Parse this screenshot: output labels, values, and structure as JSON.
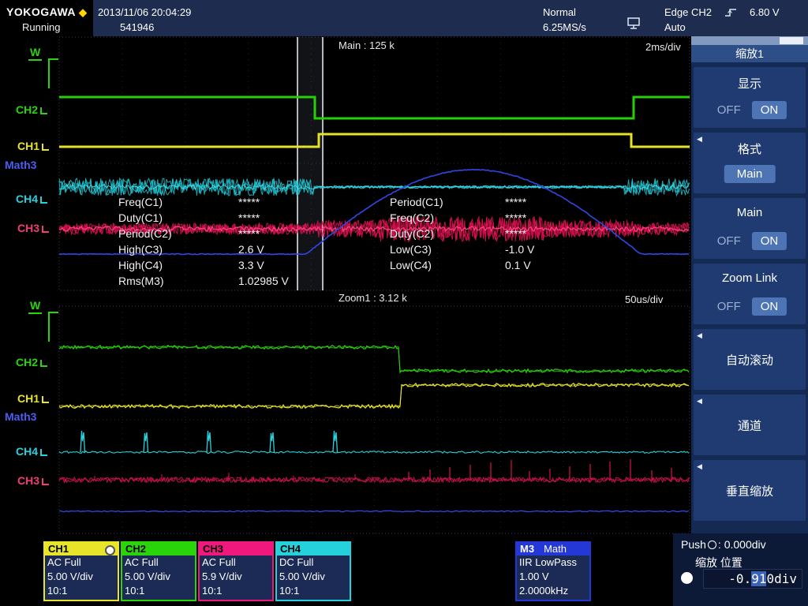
{
  "topbar": {
    "brand": "YOKOGAWA",
    "diamond": "◆",
    "datetime": "2013/11/06 20:04:29",
    "acq_count": "541946",
    "run_state": "Running",
    "trigger_mode": "Normal",
    "sample_rate": "6.25MS/s",
    "trigger_source": "Edge CH2",
    "trigger_level": "6.80 V",
    "trigger_sweep": "Auto"
  },
  "main_window": {
    "record_label": "Main : 125 k",
    "timebase": "2ms/div"
  },
  "zoom_window": {
    "record_label": "Zoom1 : 3.12 k",
    "timebase": "50us/div",
    "marker": "W"
  },
  "trace_labels": {
    "ch1": "CH1",
    "ch2": "CH2",
    "ch3": "CH3",
    "ch4": "CH4",
    "math3": "Math3"
  },
  "measurements": {
    "col1": [
      {
        "label": "Freq(C1)",
        "value": "*****"
      },
      {
        "label": "Duty(C1)",
        "value": "*****"
      },
      {
        "label": "Period(C2)",
        "value": "*****"
      },
      {
        "label": "High(C3)",
        "value": "2.6 V"
      },
      {
        "label": "High(C4)",
        "value": "3.3 V"
      },
      {
        "label": "Rms(M3)",
        "value": "1.02985 V"
      }
    ],
    "col2": [
      {
        "label": "Period(C1)",
        "value": "*****"
      },
      {
        "label": "Freq(C2)",
        "value": "*****"
      },
      {
        "label": "Duty(C2)",
        "value": "*****"
      },
      {
        "label": "Low(C3)",
        "value": "-1.0 V"
      },
      {
        "label": "Low(C4)",
        "value": "0.1 V"
      }
    ]
  },
  "sidebar": {
    "title": "缩放1",
    "display": {
      "label": "显示",
      "off": "OFF",
      "on": "ON"
    },
    "format": {
      "label": "格式",
      "button": "Main"
    },
    "main": {
      "label": "Main",
      "off": "OFF",
      "on": "ON"
    },
    "zoom_link": {
      "label": "Zoom Link",
      "off": "OFF",
      "on": "ON"
    },
    "auto_scroll": {
      "label": "自动滚动"
    },
    "channel": {
      "label": "通道"
    },
    "vertical_zoom": {
      "label": "垂直缩放"
    }
  },
  "channels": [
    {
      "name": "CH1",
      "coupling": "AC Full",
      "scale": "5.00 V/div",
      "probe": "10:1",
      "color": "#e8e42a"
    },
    {
      "name": "CH2",
      "coupling": "AC Full",
      "scale": "5.00 V/div",
      "probe": "10:1",
      "color": "#2ad40a"
    },
    {
      "name": "CH3",
      "coupling": "AC Full",
      "scale": "5.9 V/div",
      "probe": "10:1",
      "color": "#f0187c"
    },
    {
      "name": "CH4",
      "coupling": "DC Full",
      "scale": "5.00 V/div",
      "probe": "10:1",
      "color": "#25d2dc"
    }
  ],
  "math_channel": {
    "name": "M3",
    "tag": "Math",
    "filter": "IIR LowPass",
    "scale": "1.00 V",
    "cutoff": "2.0000kHz"
  },
  "zoom_position_panel": {
    "push_label": "Push",
    "push_value": ": 0.000div",
    "knob_label": "缩放 位置",
    "value_prefix": "-0.",
    "value_selected": "91",
    "value_suffix": "0div"
  },
  "colors": {
    "ch1": "#e8e42a",
    "ch2": "#2ad40a",
    "ch3": "#f0186c",
    "ch4": "#25d2dc",
    "math3": "#3246e6",
    "accent_on": "#4d74b4",
    "highlight": "#3a62b8"
  }
}
